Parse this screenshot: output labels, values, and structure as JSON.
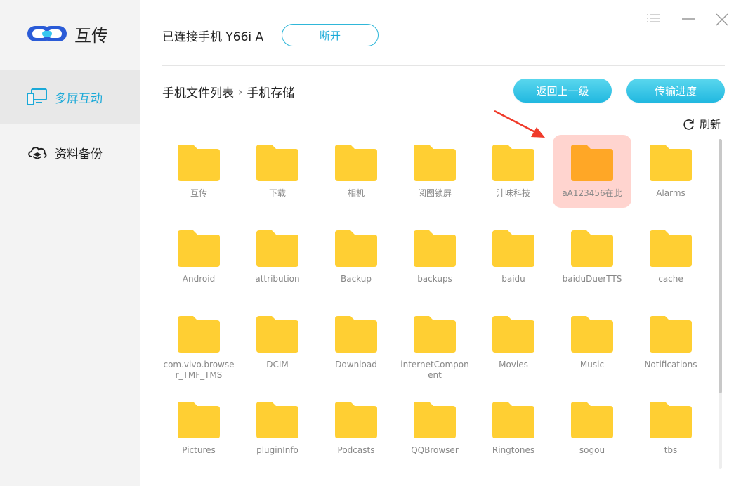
{
  "app": {
    "name": "互传"
  },
  "sidebar": {
    "items": [
      {
        "label": "多屏互动",
        "icon": "screens-icon",
        "active": true
      },
      {
        "label": "资料备份",
        "icon": "cloud-backup-icon",
        "active": false
      }
    ]
  },
  "header": {
    "device_label": "已连接手机 Y66i A",
    "disconnect_label": "断开"
  },
  "breadcrumb": [
    "手机文件列表",
    "手机存储"
  ],
  "toolbar": {
    "back_label": "返回上一级",
    "progress_label": "传输进度",
    "refresh_label": "刷新"
  },
  "folders": [
    "互传",
    "下载",
    "相机",
    "阅图锁屏",
    "汁味科技",
    "aA123456在此",
    "Alarms",
    "Android",
    "attribution",
    "Backup",
    "backups",
    "baidu",
    "baiduDuerTTS",
    "cache",
    "com.vivo.browser_TMF_TMS",
    "DCIM",
    "Download",
    "internetComponent",
    "Movies",
    "Music",
    "Notifications",
    "Pictures",
    "pluginInfo",
    "Podcasts",
    "QQBrowser",
    "Ringtones",
    "sogou",
    "tbs"
  ],
  "highlighted_folder": "aA123456在此",
  "colors": {
    "accent": "#1aa9d8",
    "folder": "#ffcf33",
    "folder_highlight": "#ffa726",
    "highlight_bg": "#ffd4cf",
    "arrow": "#f03a2a"
  }
}
